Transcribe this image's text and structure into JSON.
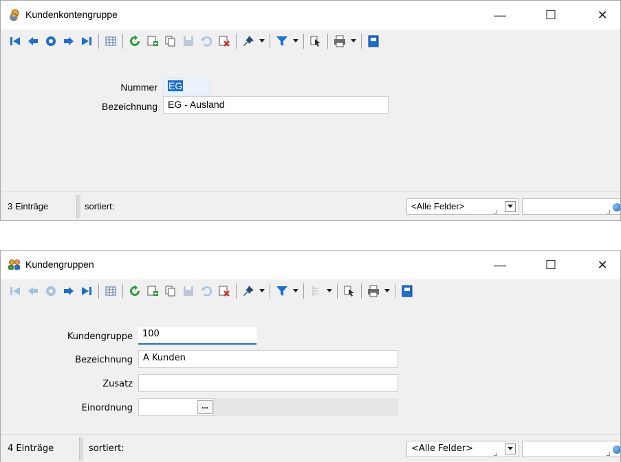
{
  "window1": {
    "title": "Kundenkontengruppe",
    "fields": {
      "nummer_label": "Nummer",
      "nummer_value": "EG",
      "bezeichnung_label": "Bezeichnung",
      "bezeichnung_value": "EG - Ausland"
    },
    "status": {
      "count": "3 Einträge",
      "sort": "sortiert:",
      "filter_combo": "<Alle Felder>"
    }
  },
  "window2": {
    "title": "Kundengruppen",
    "fields": {
      "kundengruppe_label": "Kundengruppe",
      "kundengruppe_value": "100",
      "bezeichnung_label": "Bezeichnung",
      "bezeichnung_value": "A Kunden",
      "zusatz_label": "Zusatz",
      "zusatz_value": "",
      "einordnung_label": "Einordnung",
      "einordnung_value": "",
      "browse_button": "..."
    },
    "status": {
      "count": "4 Einträge",
      "sort": "sortiert:",
      "filter_combo": "<Alle Felder>"
    }
  },
  "window_controls": {
    "minimize": "—",
    "maximize": "☐",
    "close": "✕"
  },
  "icons": [
    "first-record-icon",
    "previous-record-icon",
    "search-back-icon",
    "next-record-icon",
    "last-record-icon",
    "table-view-icon",
    "refresh-icon",
    "new-record-icon",
    "copy-record-icon",
    "save-icon",
    "undo-icon",
    "delete-icon",
    "pin-icon",
    "filter-icon",
    "tree-icon",
    "cursor-select-icon",
    "print-icon",
    "exit-icon"
  ],
  "colors": {
    "accent_blue": "#1a6fd6",
    "focus_underline": "#1a6fd6",
    "delete_red": "#d32f2f",
    "refresh_green": "#2e9e3b"
  }
}
